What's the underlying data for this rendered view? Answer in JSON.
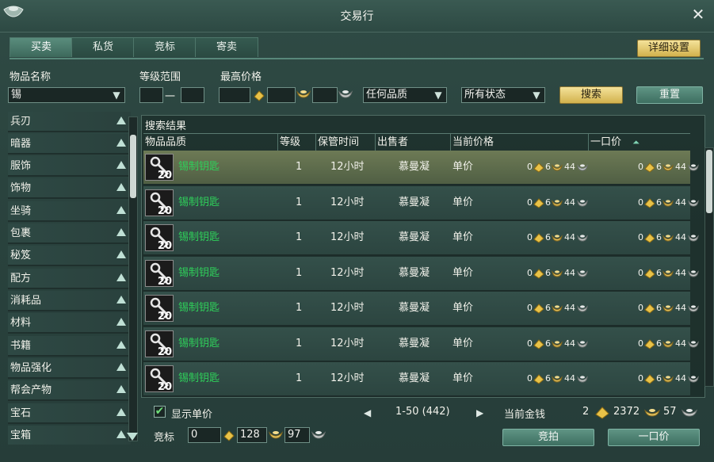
{
  "window": {
    "title": "交易行",
    "close_icon": "close-icon",
    "logo_icon": "ingot-logo-icon"
  },
  "tabs": [
    {
      "label": "买卖",
      "active": true
    },
    {
      "label": "私货",
      "active": false
    },
    {
      "label": "竞标",
      "active": false
    },
    {
      "label": "寄卖",
      "active": false
    }
  ],
  "detail_settings_label": "详细设置",
  "filters": {
    "item_name_label": "物品名称",
    "item_name_value": "锡",
    "level_range_label": "等级范围",
    "level_min": "",
    "level_sep": "一",
    "level_max": "",
    "max_price_label": "最高价格",
    "price_gold": "",
    "price_silver": "",
    "price_copper": "",
    "quality_value": "任何品质",
    "status_value": "所有状态",
    "search_label": "搜索",
    "reset_label": "重置"
  },
  "categories": [
    "兵刃",
    "暗器",
    "服饰",
    "饰物",
    "坐骑",
    "包裹",
    "秘笈",
    "配方",
    "消耗品",
    "材料",
    "书籍",
    "物品强化",
    "帮会产物",
    "宝石",
    "宝箱"
  ],
  "results": {
    "title": "搜索结果",
    "columns": [
      "物品品质",
      "等级",
      "保管时间",
      "出售者",
      "当前价格",
      "一口价"
    ],
    "rows": [
      {
        "count": "20",
        "name": "锡制钥匙",
        "level": "1",
        "time": "12小时",
        "seller": "慕曼凝",
        "price_type": "单价",
        "cur_gold": "0",
        "cur_silver": "6",
        "cur_copper": "44",
        "buy_gold": "0",
        "buy_silver": "6",
        "buy_copper": "44",
        "selected": true
      },
      {
        "count": "20",
        "name": "锡制钥匙",
        "level": "1",
        "time": "12小时",
        "seller": "慕曼凝",
        "price_type": "单价",
        "cur_gold": "0",
        "cur_silver": "6",
        "cur_copper": "44",
        "buy_gold": "0",
        "buy_silver": "6",
        "buy_copper": "44",
        "selected": false
      },
      {
        "count": "20",
        "name": "锡制钥匙",
        "level": "1",
        "time": "12小时",
        "seller": "慕曼凝",
        "price_type": "单价",
        "cur_gold": "0",
        "cur_silver": "6",
        "cur_copper": "44",
        "buy_gold": "0",
        "buy_silver": "6",
        "buy_copper": "44",
        "selected": false
      },
      {
        "count": "20",
        "name": "锡制钥匙",
        "level": "1",
        "time": "12小时",
        "seller": "慕曼凝",
        "price_type": "单价",
        "cur_gold": "0",
        "cur_silver": "6",
        "cur_copper": "44",
        "buy_gold": "0",
        "buy_silver": "6",
        "buy_copper": "44",
        "selected": false
      },
      {
        "count": "20",
        "name": "锡制钥匙",
        "level": "1",
        "time": "12小时",
        "seller": "慕曼凝",
        "price_type": "单价",
        "cur_gold": "0",
        "cur_silver": "6",
        "cur_copper": "44",
        "buy_gold": "0",
        "buy_silver": "6",
        "buy_copper": "44",
        "selected": false
      },
      {
        "count": "20",
        "name": "锡制钥匙",
        "level": "1",
        "time": "12小时",
        "seller": "慕曼凝",
        "price_type": "单价",
        "cur_gold": "0",
        "cur_silver": "6",
        "cur_copper": "44",
        "buy_gold": "0",
        "buy_silver": "6",
        "buy_copper": "44",
        "selected": false
      },
      {
        "count": "20",
        "name": "锡制钥匙",
        "level": "1",
        "time": "12小时",
        "seller": "慕曼凝",
        "price_type": "单价",
        "cur_gold": "0",
        "cur_silver": "6",
        "cur_copper": "44",
        "buy_gold": "0",
        "buy_silver": "6",
        "buy_copper": "44",
        "selected": false
      }
    ]
  },
  "bottom": {
    "show_unit_price_label": "显示单价",
    "show_unit_price_checked": true,
    "page_range": "1-50 (442)",
    "money_label": "当前金钱",
    "money_gold": "2",
    "money_silver": "2372",
    "money_copper": "57",
    "bid_label": "竞标",
    "bid_gold": "0",
    "bid_silver": "128",
    "bid_copper": "97",
    "bid_button_label": "竞拍",
    "buyout_button_label": "一口价"
  },
  "colors": {
    "item_name_green": "#2fcf5a",
    "gold_button": "#e4c86a",
    "teal_button": "#4f8474"
  }
}
